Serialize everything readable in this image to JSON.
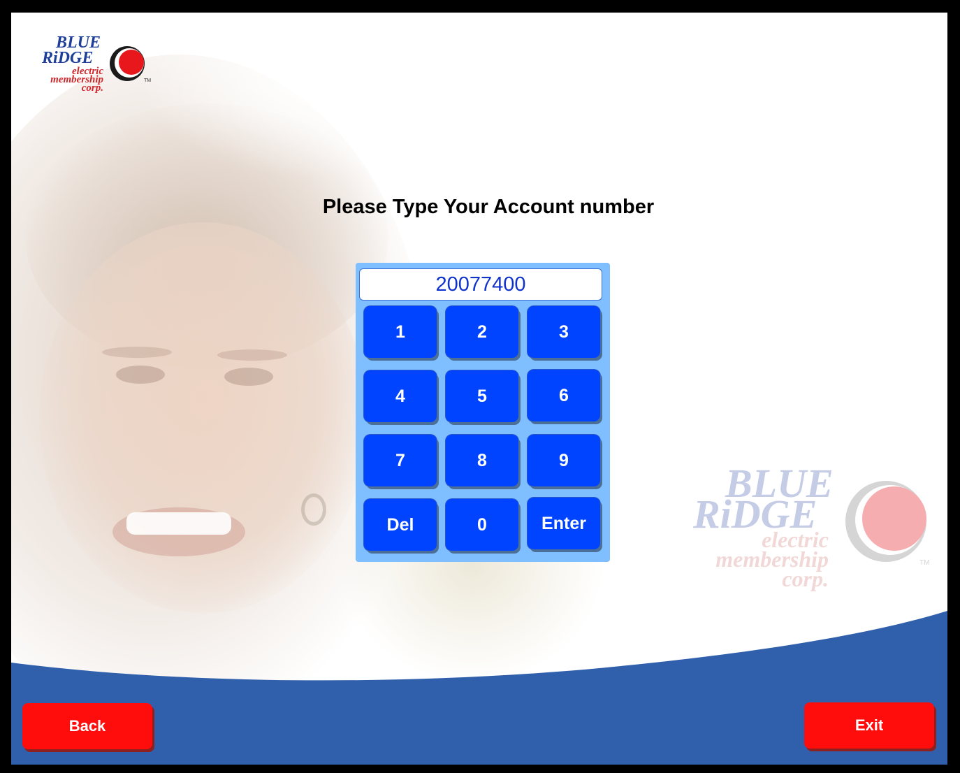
{
  "brand": {
    "line1": "BLUE",
    "line2": "RiDGE",
    "sub1": "electric",
    "sub2": "membership",
    "sub3": "corp.",
    "tm": "TM",
    "circle_color": "#e8171c",
    "text_color": "#1d3f9a"
  },
  "prompt": "Please Type Your Account number",
  "account_field": {
    "value": "20077400"
  },
  "keypad": {
    "keys": [
      "1",
      "2",
      "3",
      "4",
      "5",
      "6",
      "7",
      "8",
      "9",
      "Del",
      "0",
      "Enter"
    ]
  },
  "nav": {
    "back_label": "Back",
    "exit_label": "Exit"
  },
  "colors": {
    "key_blue": "#0044ff",
    "keypad_panel": "#7fbfff",
    "button_red": "#ff0c0c",
    "band_blue": "#305fab"
  }
}
